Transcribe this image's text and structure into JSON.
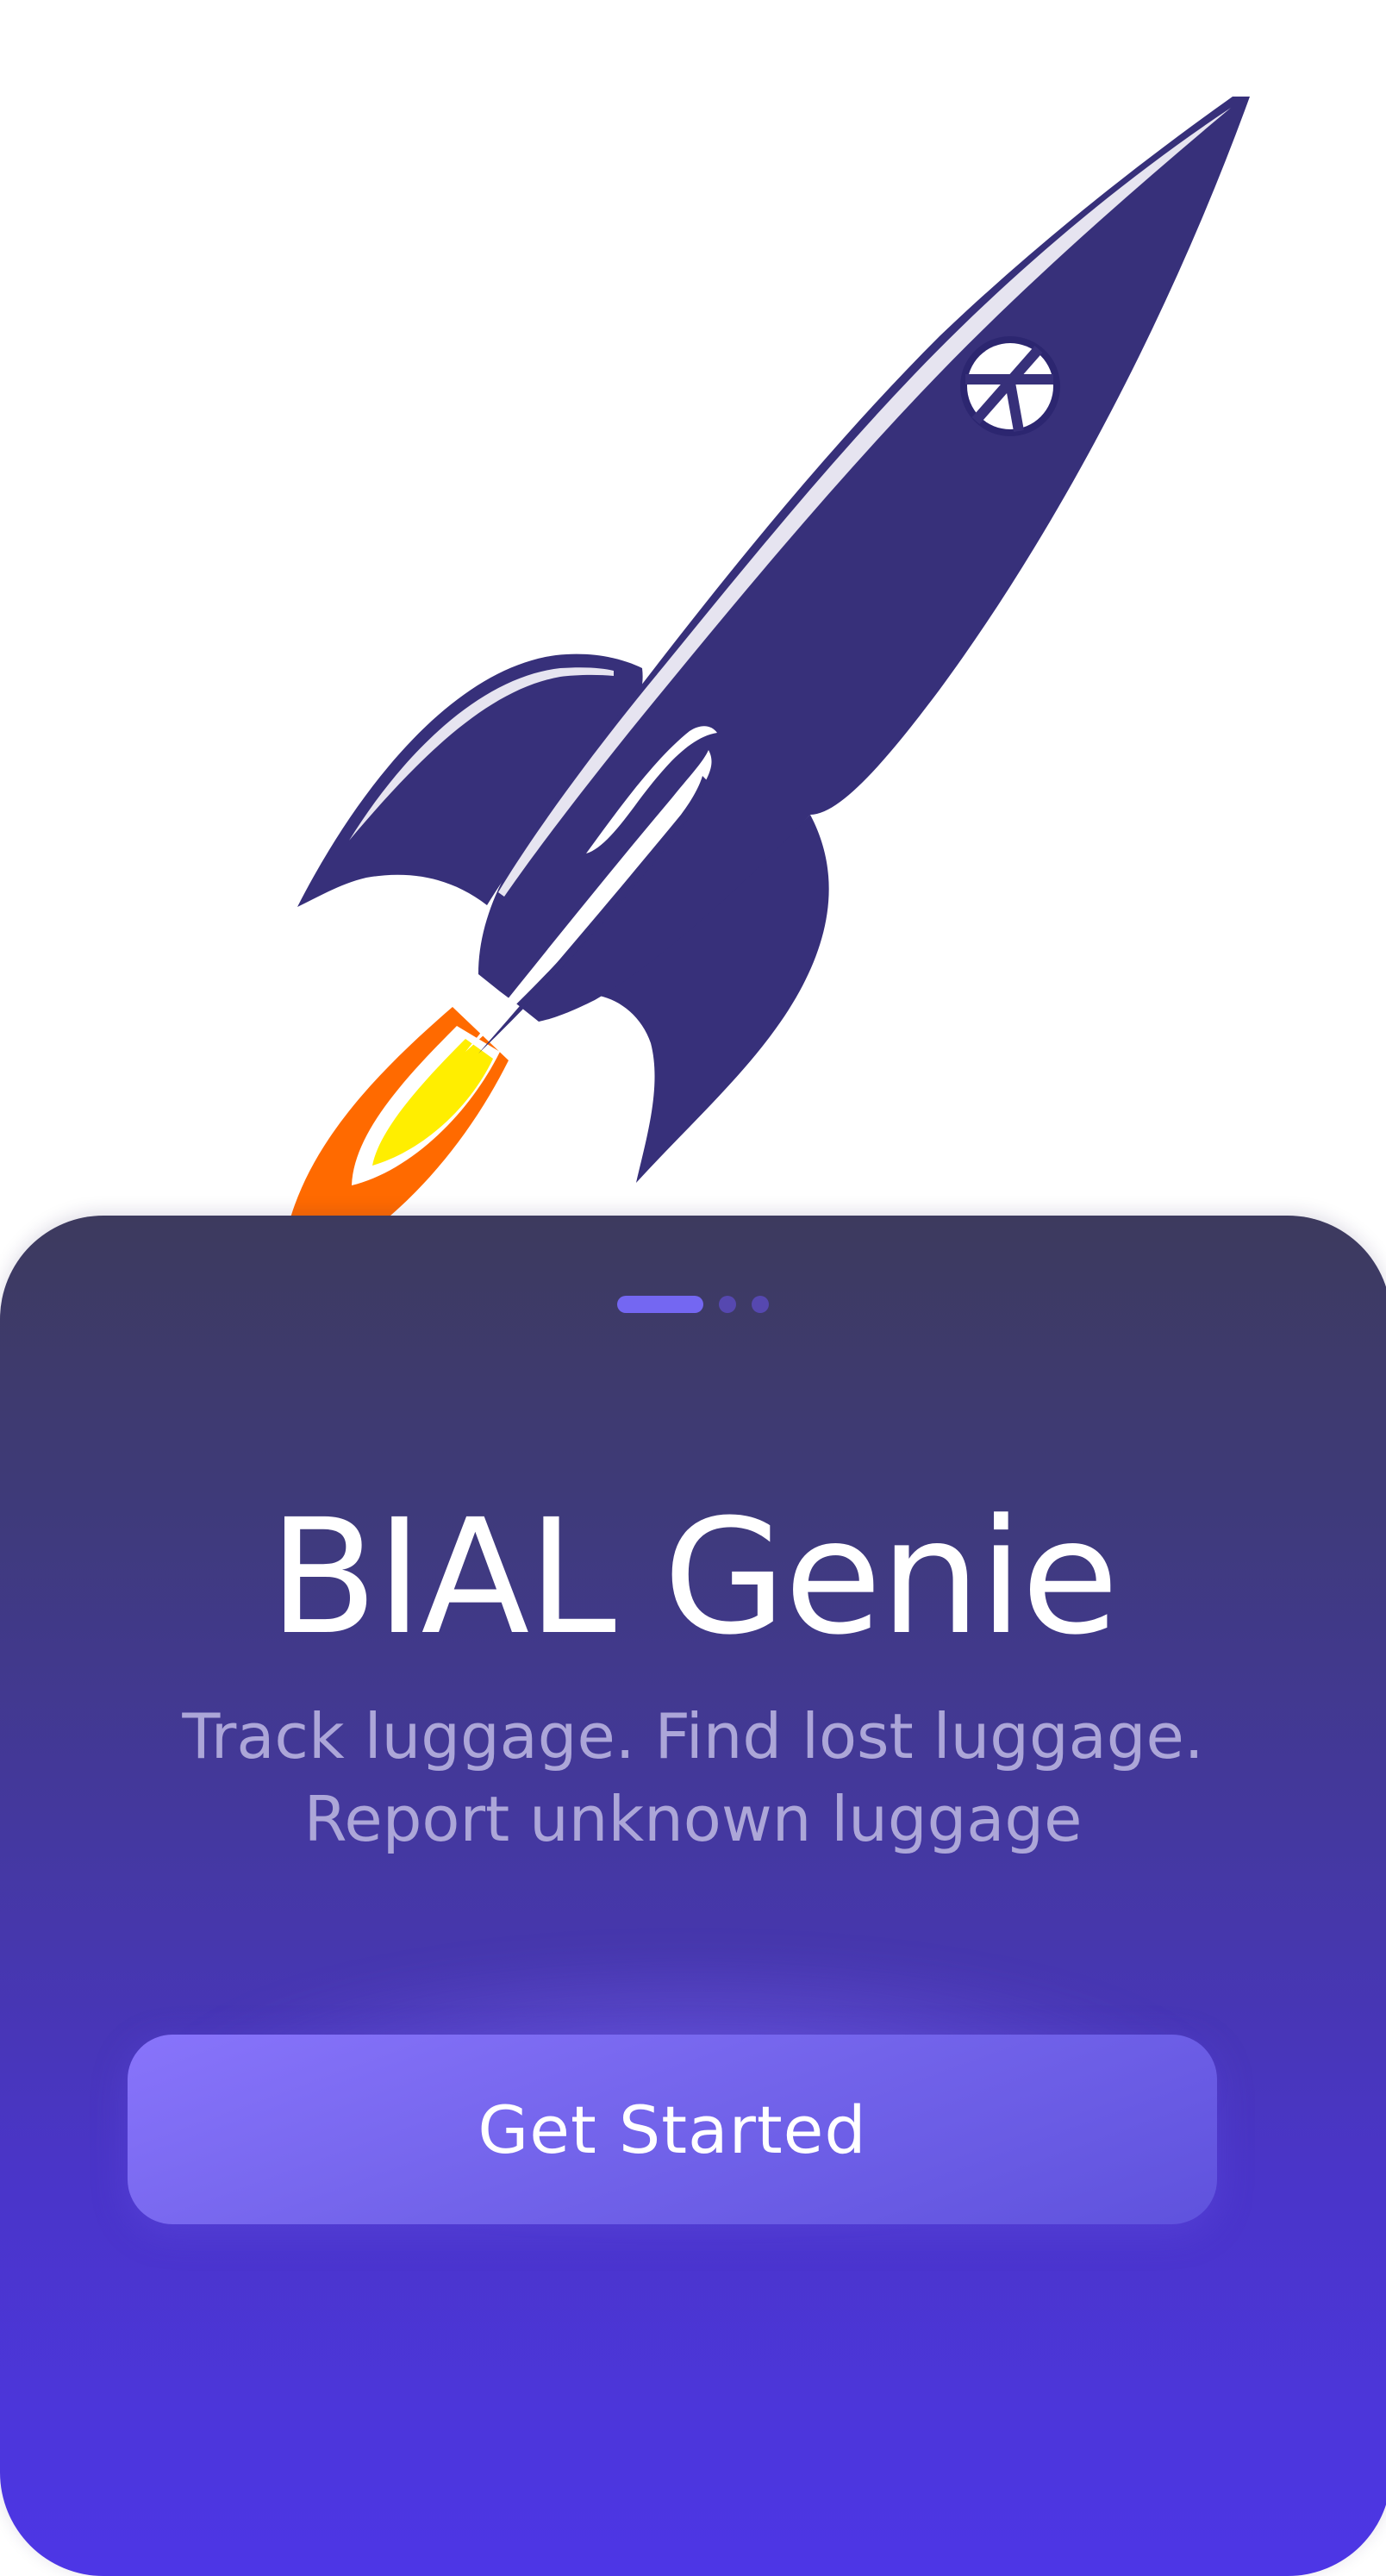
{
  "app": {
    "title": "BIAL Genie",
    "tagline_line1": "Track luggage. Find lost luggage.",
    "tagline_line2": "Report unknown luggage"
  },
  "pager": {
    "total": 3,
    "active_index": 0
  },
  "actions": {
    "get_started_label": "Get Started"
  },
  "illustration": {
    "icon": "rocket-icon",
    "emblem_icon": "peace-sign-icon"
  },
  "colors": {
    "rocket_body": "#37307a",
    "flame_outer": "#ff6a00",
    "flame_inner": "#ffee00",
    "card_top": "#3d3a5e",
    "card_bottom": "#4d36e6",
    "button": "#7a6bf5",
    "subtitle": "#aca6d8"
  }
}
